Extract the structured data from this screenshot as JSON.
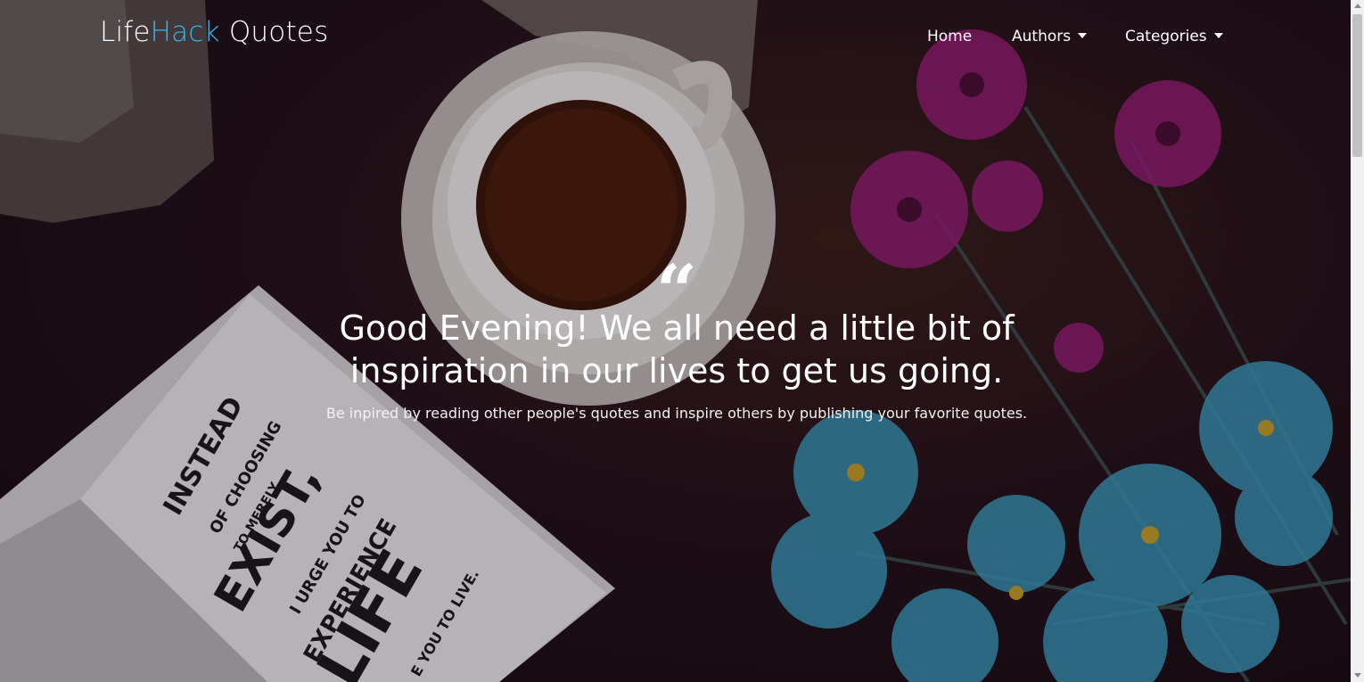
{
  "brand": {
    "part1": "Life",
    "part2": "Hack",
    "part3": " Quotes",
    "accent_color": "#35b6e6"
  },
  "nav": {
    "home_label": "Home",
    "authors_label": "Authors",
    "categories_label": "Categories"
  },
  "hero": {
    "quote_icon": "quote-open-icon",
    "headline_line1": "Good Evening! We all need a little bit of",
    "headline_line2": "inspiration in our lives to get us going.",
    "subline": "Be inpired by reading other people's quotes and inspire others by publishing your favorite quotes."
  },
  "background_image": {
    "notebook_text": [
      "INSTEAD",
      "OF CHOOSING",
      "TO MERELY",
      "EXIST,",
      "I URGE YOU TO",
      "EXPERIENCE",
      "LIFE",
      "E YOU TO LIVE."
    ]
  }
}
